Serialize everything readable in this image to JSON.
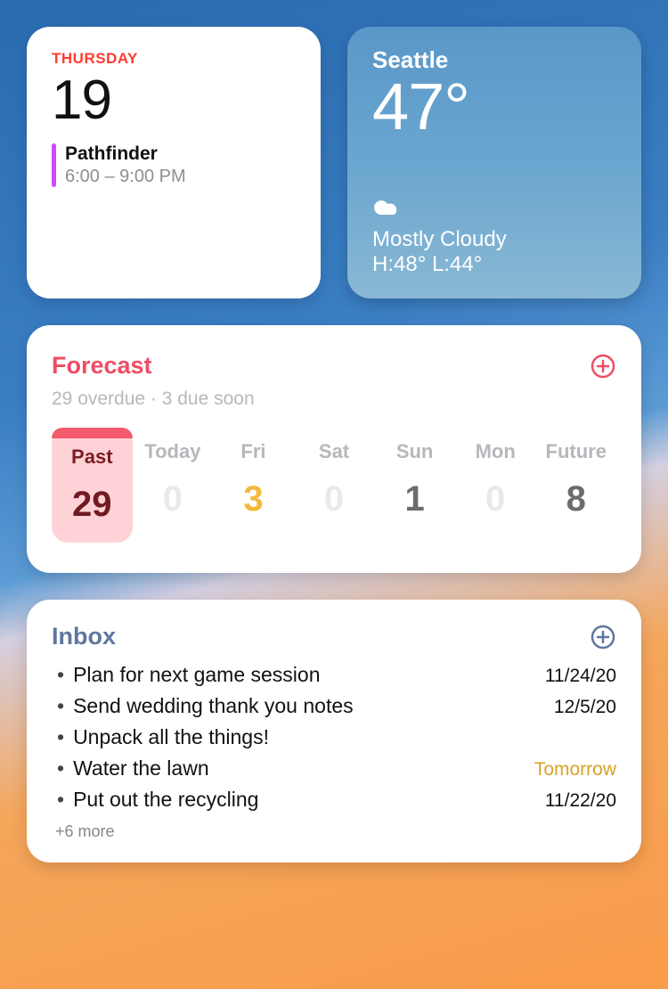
{
  "calendar": {
    "day_name": "THURSDAY",
    "day_num": "19",
    "event": {
      "title": "Pathfinder",
      "time": "6:00 – 9:00 PM"
    }
  },
  "weather": {
    "city": "Seattle",
    "temp": "47°",
    "condition": "Mostly Cloudy",
    "hilo": "H:48° L:44°"
  },
  "forecast": {
    "title": "Forecast",
    "subtitle": "29 overdue  ·  3 due soon",
    "days": [
      {
        "label": "Past",
        "count": "29",
        "style": "past"
      },
      {
        "label": "Today",
        "count": "0",
        "style": "dim"
      },
      {
        "label": "Fri",
        "count": "3",
        "style": "yellow"
      },
      {
        "label": "Sat",
        "count": "0",
        "style": "dim"
      },
      {
        "label": "Sun",
        "count": "1",
        "style": "dark"
      },
      {
        "label": "Mon",
        "count": "0",
        "style": "dim"
      },
      {
        "label": "Future",
        "count": "8",
        "style": "dark"
      }
    ]
  },
  "inbox": {
    "title": "Inbox",
    "items": [
      {
        "text": "Plan for next game session",
        "date": "11/24/20",
        "date_style": ""
      },
      {
        "text": "Send wedding thank you notes",
        "date": "12/5/20",
        "date_style": ""
      },
      {
        "text": "Unpack all the things!",
        "date": "",
        "date_style": ""
      },
      {
        "text": "Water the lawn",
        "date": "Tomorrow",
        "date_style": "tom"
      },
      {
        "text": "Put out the recycling",
        "date": "11/22/20",
        "date_style": ""
      }
    ],
    "more": "+6 more"
  },
  "colors": {
    "forecast_plus": "#ee4d64",
    "inbox_plus": "#5f77a0"
  }
}
